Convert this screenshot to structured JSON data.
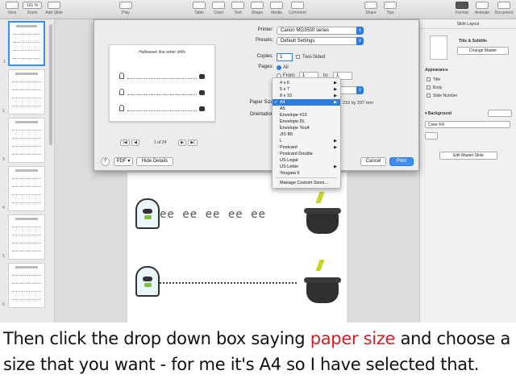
{
  "toolbar": {
    "view_label": "View",
    "zoom_value": "101 %",
    "zoom_label": "Zoom",
    "add_slide_label": "Add Slide",
    "play_label": "Play",
    "table_label": "Table",
    "chart_label": "Chart",
    "text_label": "Text",
    "shape_label": "Shape",
    "media_label": "Media",
    "comment_label": "Comment",
    "share_label": "Share",
    "tips_label": "Tips",
    "format_label": "Format",
    "animate_label": "Animate",
    "document_label": "Document"
  },
  "navigator": {
    "slide_numbers": [
      "1",
      "2",
      "3",
      "4",
      "5",
      "6"
    ]
  },
  "inspector": {
    "header": "Slide Layout",
    "layout_name": "Title & Subtitle",
    "change_master": "Change Master",
    "appearance_title": "Appearance",
    "opt_title": "Title",
    "opt_body": "Body",
    "opt_slide_number": "Slide Number",
    "background_label": "Background",
    "fill_value": "Color Fill",
    "edit_master": "Edit Master Slide"
  },
  "print_dialog": {
    "preview_title": "Halloween line writer drills",
    "page_indicator": "1 of 24",
    "printer_label": "Printer:",
    "printer_value": "Canon MG3500 series",
    "presets_label": "Presets:",
    "presets_value": "Default Settings",
    "copies_label": "Copies:",
    "copies_value": "1",
    "two_sided_label": "Two-Sided",
    "pages_label": "Pages:",
    "pages_all": "All",
    "pages_from": "From:",
    "from_value": "1",
    "to_label": "to:",
    "to_value": "1",
    "paper_size_label": "Paper Size",
    "paper_dims": "210 by 297 mm",
    "orientation_label": "Orientation",
    "help_label": "?",
    "pdf_label": "PDF",
    "hide_details": "Hide Details",
    "cancel": "Cancel",
    "print": "Print",
    "nav_first": "|◀",
    "nav_prev": "◀",
    "nav_next": "▶",
    "nav_last": "▶|"
  },
  "paper_menu": {
    "items": [
      {
        "label": "4 x 6",
        "sub": true
      },
      {
        "label": "5 x 7",
        "sub": true
      },
      {
        "label": "8 x 10",
        "sub": true
      },
      {
        "label": "A4",
        "sub": true,
        "selected": true
      },
      {
        "label": "A5",
        "sub": false
      },
      {
        "label": "Envelope #10",
        "sub": false
      },
      {
        "label": "Envelope DL",
        "sub": false
      },
      {
        "label": "Envelope You4",
        "sub": false
      },
      {
        "label": "JIS B5",
        "sub": false
      },
      {
        "label": "L",
        "sub": true
      },
      {
        "label": "Postcard",
        "sub": true
      },
      {
        "label": "Postcard Double",
        "sub": false
      },
      {
        "label": "US Legal",
        "sub": false
      },
      {
        "label": "US Letter",
        "sub": true
      },
      {
        "label": "Yougata 6",
        "sub": false
      },
      {
        "label": "Manage Custom Sizes...",
        "sub": false
      }
    ],
    "checkmark": "✓",
    "submenu_arrow": "▶"
  },
  "slide": {
    "trace_row_1": "ee ee ee ee ee"
  },
  "caption": {
    "part1": "Then click the drop down box saying ",
    "highlight": "paper size",
    "part2": " and choose a size that you want - for me it's A4 so I have selected that."
  },
  "colors": {
    "accent": "#2f7ce0",
    "caption_highlight": "#d42020"
  }
}
